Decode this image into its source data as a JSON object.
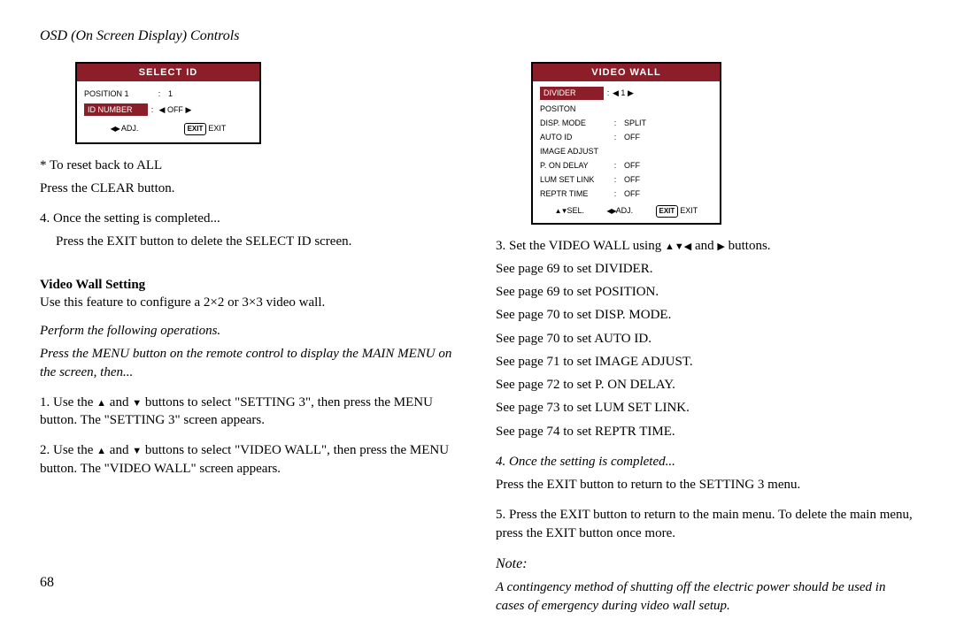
{
  "header": {
    "title": "OSD (On Screen Display) Controls"
  },
  "page_number": "68",
  "osd_select_id": {
    "title": "SELECT ID",
    "row1_label": "POSITION 1",
    "row1_value": "1",
    "row2_label": "ID NUMBER",
    "row2_value": "OFF",
    "foot_adj": "ADJ.",
    "foot_exit_btn": "EXIT",
    "foot_exit": "EXIT"
  },
  "osd_video_wall": {
    "title": "VIDEO WALL",
    "rows": [
      {
        "label": "DIVIDER",
        "value": "1",
        "hl": true,
        "arrows": true
      },
      {
        "label": "POSITON",
        "value": "",
        "hl": false,
        "arrows": false
      },
      {
        "label": "DISP. MODE",
        "value": "SPLIT",
        "hl": false,
        "arrows": false
      },
      {
        "label": "AUTO ID",
        "value": "OFF",
        "hl": false,
        "arrows": false
      },
      {
        "label": "IMAGE ADJUST",
        "value": "",
        "hl": false,
        "arrows": false
      },
      {
        "label": "P. ON DELAY",
        "value": "OFF",
        "hl": false,
        "arrows": false
      },
      {
        "label": "LUM SET LINK",
        "value": "OFF",
        "hl": false,
        "arrows": false
      },
      {
        "label": "REPTR TIME",
        "value": "OFF",
        "hl": false,
        "arrows": false
      }
    ],
    "foot_sel": "SEL.",
    "foot_adj": "ADJ.",
    "foot_exit_btn": "EXIT",
    "foot_exit": "EXIT"
  },
  "left": {
    "reset1": "* To reset back to ALL",
    "reset2": "Press the CLEAR button.",
    "step4a": "4. Once the setting is completed...",
    "step4b": "Press the EXIT button to delete the SELECT ID screen.",
    "vw_title": "Video Wall Setting",
    "vw_intro": "Use this feature to configure a 2×2 or 3×3 video wall.",
    "perform": "Perform the following operations.",
    "press_menu": "Press the MENU button on the remote control to display the MAIN MENU on the screen, then...",
    "s1a": "1. Use the ",
    "s1b": " and ",
    "s1c": " buttons to select \"SETTING 3\", then press the MENU button. The \"SETTING 3\" screen appears.",
    "s2a": "2. Use the ",
    "s2b": " and ",
    "s2c": " buttons to select \"VIDEO WALL\", then press the MENU button. The \"VIDEO WALL\" screen appears."
  },
  "right": {
    "s3a": "3. Set the VIDEO WALL using ",
    "s3b": " and ",
    "s3c": " buttons.",
    "p69a": "See page 69 to set DIVIDER.",
    "p69b": "See page 69 to set POSITION.",
    "p70a": "See page 70 to set DISP. MODE.",
    "p70b": "See page 70 to set AUTO ID.",
    "p71": "See page 71 to set IMAGE ADJUST.",
    "p72": "See page 72 to set P. ON DELAY.",
    "p73": "See page 73 to set LUM SET LINK.",
    "p74": "See page 74 to set REPTR TIME.",
    "s4_title": "4. Once the setting is completed...",
    "s4_body": "Press the EXIT button to return to the SETTING 3 menu.",
    "s5": "5. Press the EXIT button to return to the main menu. To delete the main menu, press the EXIT button once more.",
    "note_title": "Note:",
    "note_body": "A contingency method of shutting off the electric power should be used in cases of emergency during video wall setup."
  }
}
